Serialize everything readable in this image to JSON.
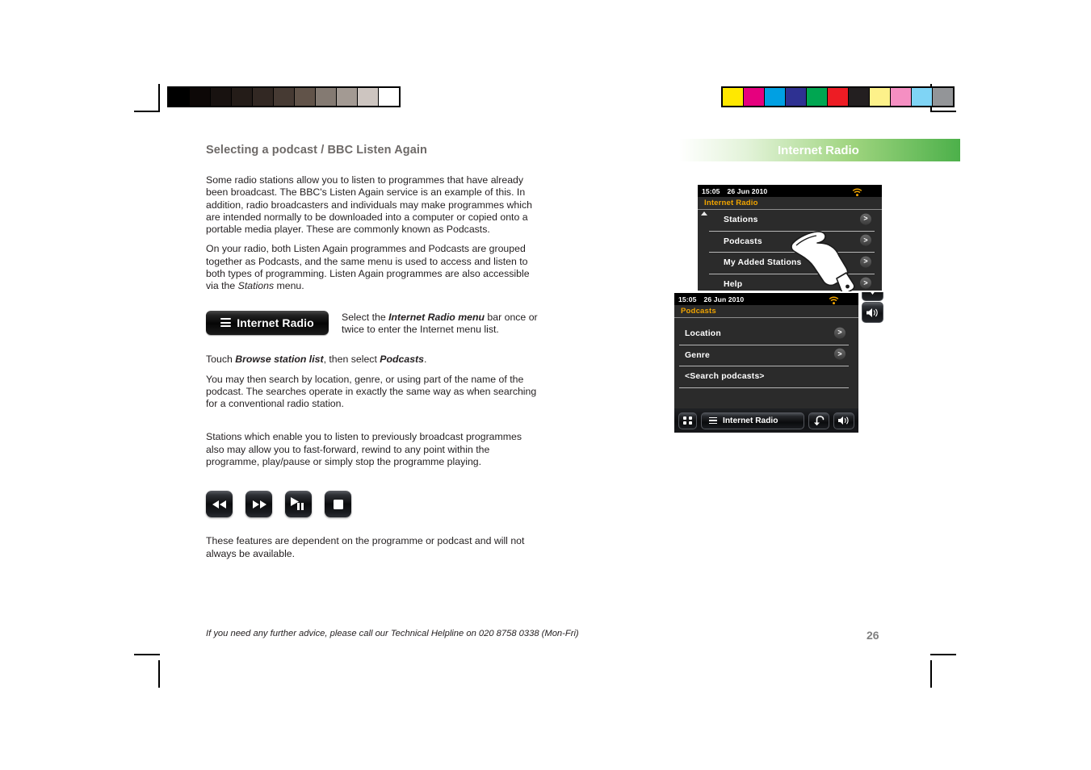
{
  "page": {
    "section_title": "Selecting a podcast / BBC Listen Again",
    "page_number": "26",
    "footer_note": "If you need any further advice, please call our Technical Helpline on 020 8758 0338 (Mon-Fri)"
  },
  "body": {
    "para1": "Some radio stations allow you to listen to programmes that have already been broadcast. The BBC's Listen Again service is an example of this. In addition, radio broadcasters and individuals may make programmes which are intended normally to be downloaded into a computer or copied onto a portable media player. These are commonly known as Podcasts.",
    "para2_a": "On your radio, both Listen Again programmes and Podcasts are grouped together as Podcasts, and the same menu is used to access and listen to both types of programming. Listen Again programmes are also accessible via the ",
    "para2_italic": "Stations",
    "para2_b": " menu.",
    "pill_caption_a": "Select the ",
    "pill_caption_bold": "Internet Radio menu",
    "pill_caption_b": " bar once or twice to enter the Internet menu list.",
    "touch_a": "Touch ",
    "touch_bold1": "Browse station list",
    "touch_b": ", then select ",
    "touch_bold2": "Podcasts",
    "touch_c": ".",
    "para3": "You may then search by location, genre, or using part of the name of the podcast. The searches operate in exactly the same way as when searching for a conventional radio station.",
    "para4": "Stations which enable you to listen to previously broadcast programmes also may allow you to fast-forward, rewind to any point within the programme, play/pause or simply stop the programme playing.",
    "para5": "These features are dependent on the programme or podcast and will not always be available."
  },
  "pill_button": {
    "label": "Internet Radio"
  },
  "transport_buttons": [
    {
      "name": "rewind-button",
      "icon": "rewind-icon"
    },
    {
      "name": "fast-forward-button",
      "icon": "fast-forward-icon"
    },
    {
      "name": "play-pause-button",
      "icon": "play-pause-icon"
    },
    {
      "name": "stop-button",
      "icon": "stop-icon"
    }
  ],
  "right_panel": {
    "header_title": "Internet Radio"
  },
  "screen1": {
    "time": "15:05",
    "date": "26 Jun 2010",
    "title": "Internet Radio",
    "items": [
      {
        "label": "Stations",
        "chevron": ">"
      },
      {
        "label": "Podcasts",
        "chevron": ">"
      },
      {
        "label": "My Added Stations",
        "chevron": ">"
      },
      {
        "label": "Help",
        "chevron": ">"
      }
    ]
  },
  "screen2": {
    "time": "15:05",
    "date": "26 Jun 2010",
    "title": "Podcasts",
    "items": [
      {
        "label": "Location",
        "chevron": ">"
      },
      {
        "label": "Genre",
        "chevron": ">"
      },
      {
        "label": "<Search podcasts>",
        "chevron": ""
      }
    ],
    "bottom_bar": {
      "internet_radio_label": "Internet Radio"
    }
  },
  "calibration": {
    "gray_swatches": [
      "#000000",
      "#0d0807",
      "#181210",
      "#241c18",
      "#322823",
      "#463a33",
      "#615349",
      "#847a72",
      "#a39a93",
      "#cdc5c0",
      "#ffffff"
    ],
    "color_swatches": [
      "#ffe800",
      "#e6007e",
      "#00a0e3",
      "#2e3192",
      "#00a651",
      "#ed1c24",
      "#231f20",
      "#fdf18a",
      "#f58fc2",
      "#7fd4f5",
      "#939598"
    ]
  },
  "colors": {
    "accent_green": "#4cb04a",
    "screen_title_orange": "#f0a400",
    "heading_gray": "#6e6a68"
  }
}
